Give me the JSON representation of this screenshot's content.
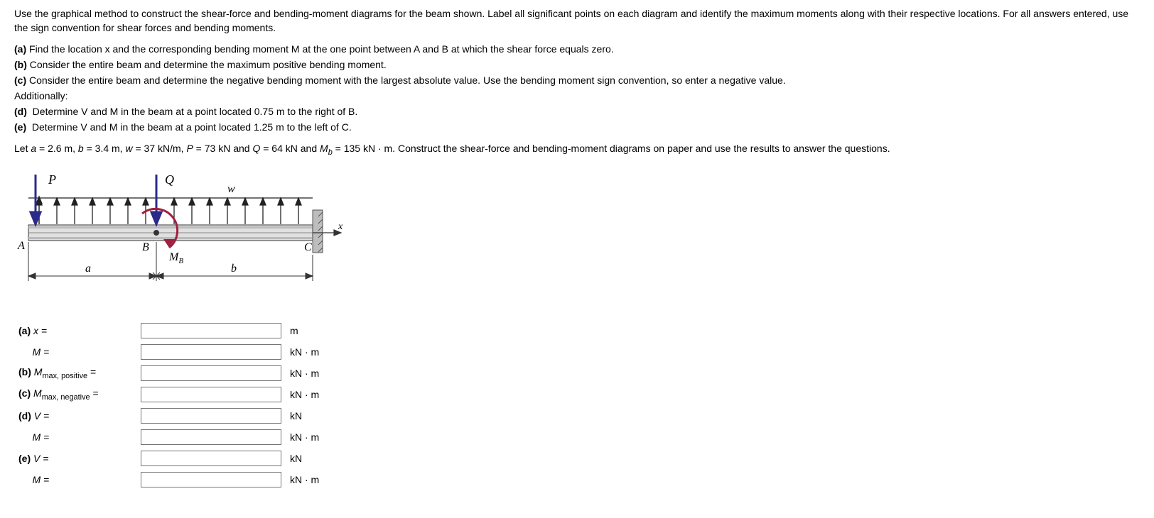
{
  "problem": {
    "intro": "Use the graphical method to construct the shear-force and bending-moment diagrams for the beam shown. Label all significant points on each diagram and identify the maximum moments along with their respective locations. For all answers entered, use the sign convention for shear forces and bending moments.",
    "part_a": "Find the location x and the corresponding bending moment M at the one point between A and B at which the shear force equals zero.",
    "part_b": "Consider the entire beam and determine the maximum positive bending moment.",
    "part_c": "Consider the entire beam and determine the negative bending moment with the largest absolute value.  Use the bending moment sign convention, so enter a negative value.",
    "additionally": "Additionally:",
    "part_d": "Determine V and M in the beam at a point located 0.75 m to the right of B.",
    "part_e": "Determine V and M in the beam at a point located 1.25 m to the left of C."
  },
  "given": {
    "prefix": "Let ",
    "a_label": "a",
    "a_val": " = 2.6 m, ",
    "b_label": "b",
    "b_val": " = 3.4 m, ",
    "w_label": "w",
    "w_val": " = 37 kN/m, ",
    "P_label": "P",
    "P_val": " = 73 kN and ",
    "Q_label": "Q",
    "Q_val": " = 64 kN and ",
    "Mb_label": "M",
    "Mb_sub": "b",
    "Mb_val": " = 135 kN · m. ",
    "tail": "Construct the shear-force and bending-moment diagrams on paper and use the results to answer the questions."
  },
  "labels": {
    "a_tag": "(a)",
    "b_tag": "(b)",
    "c_tag": "(c)",
    "d_tag": "(d)",
    "e_tag": "(e)"
  },
  "answers": {
    "a_x": {
      "label": "x =",
      "unit": "m",
      "value": ""
    },
    "a_M": {
      "label": "M =",
      "unit": "kN · m",
      "value": ""
    },
    "b_M": {
      "label_prefix": "M",
      "label_sub": "max, positive",
      "label_suffix": " =",
      "unit": "kN · m",
      "value": ""
    },
    "c_M": {
      "label_prefix": "M",
      "label_sub": "max, negative",
      "label_suffix": " =",
      "unit": "kN · m",
      "value": ""
    },
    "d_V": {
      "label": "V =",
      "unit": "kN",
      "value": ""
    },
    "d_M": {
      "label": "M =",
      "unit": "kN · m",
      "value": ""
    },
    "e_V": {
      "label": "V =",
      "unit": "kN",
      "value": ""
    },
    "e_M": {
      "label": "M =",
      "unit": "kN · m",
      "value": ""
    }
  },
  "figure": {
    "P": "P",
    "Q": "Q",
    "w": "w",
    "A": "A",
    "B": "B",
    "C": "C",
    "MB_prefix": "M",
    "MB_sub": "B",
    "a_dim": "a",
    "b_dim": "b",
    "x": "x"
  }
}
